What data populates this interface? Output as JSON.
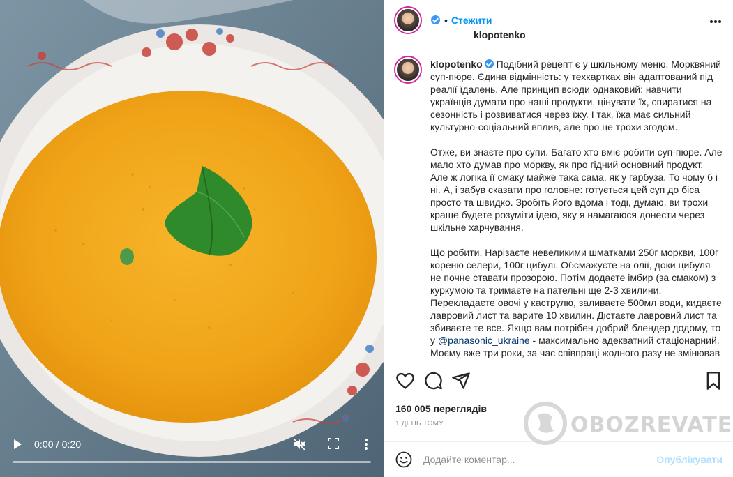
{
  "video": {
    "time": "0:00 / 0:20",
    "progress": 0,
    "icons": [
      "play-icon",
      "mute-icon",
      "fullscreen-icon",
      "more-vert-icon"
    ]
  },
  "header": {
    "username": "klopotenko",
    "separator": "•",
    "follow_label": "Стежити"
  },
  "caption": {
    "username": "klopotenko",
    "p1": "Подібний рецепт є у шкільному меню. Морквяний суп-пюре. Єдина відмінність: у техкартках він адаптований під реалії їдалень. Але принцип всюди однаковий: навчити українців думати про наші продукти, цінувати їх, спиратися на сезонність і розвиватися через їжу. І так, їжа має сильний культурно-соціальний вплив, але про це трохи згодом.",
    "p2": "Отже, ви знаєте про супи. Багато хто вміє робити суп-пюре. Але мало хто думав про моркву, як про гідний основний продукт. Але ж логіка її смаку майже така сама, як у гарбуза. То чому б і ні. А, і забув сказати про головне: готується цей суп до біса просто та швидко. Зробіть його вдома і тоді, думаю, ви трохи краще будете розуміти ідею, яку я намагаюся донести через шкільне харчування.",
    "p3_a": "Що робити. Нарізаєте невеликими шматками 250г моркви, 100г кореню селери, 100г цибулі. Обсмажуєте на олії, доки цибуля не почне ставати прозорою. Потім додаєте імбир (за смаком) з куркумою та тримаєте на пательні ще 2-3 хвилини. Перекладаєте овочі у каструлю, заливаєте 500мл води, кидаєте лавровий лист та варите 10 хвилин. Дістаєте лавровий лист та збиваєте те все. Якщо вам потрібен добрий блендер додому, то у",
    "mention": "@panasonic_ukraine",
    "p3_b": " - максимально адекватний стаціонарний. Моєму вже три роки, за час співпраці жодного разу не змінював"
  },
  "actions": {
    "icons": [
      "heart-icon",
      "comment-icon",
      "share-icon",
      "bookmark-icon"
    ]
  },
  "stats": {
    "views": "160 005 переглядів",
    "ago": "1 ДЕНЬ ТОМУ"
  },
  "comment": {
    "placeholder": "Додайте коментар...",
    "publish_label": "Опублікувати"
  },
  "watermark": {
    "text": "OBOZREVATEL"
  },
  "colors": {
    "accent": "#0095f6",
    "publish_disabled": "#b2dffc",
    "soup": "#f2a81c",
    "verified": "#3897f0"
  }
}
